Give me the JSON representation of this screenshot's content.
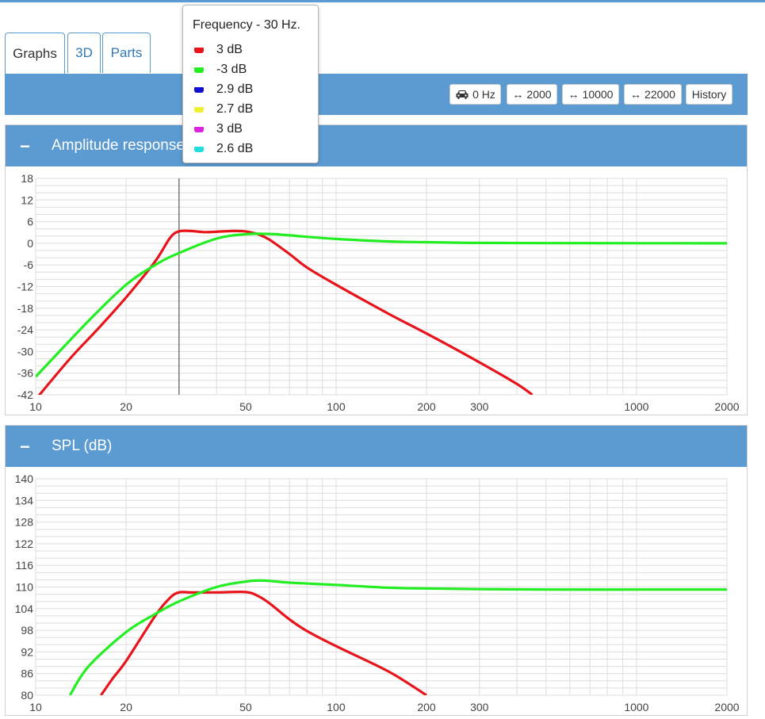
{
  "tabs": [
    {
      "label": "Graphs",
      "active": true
    },
    {
      "label": "3D",
      "active": false
    },
    {
      "label": "Parts",
      "active": false
    }
  ],
  "toolbar": {
    "car": "0 Hz",
    "range2000": "2000",
    "range10000": "10000",
    "range22000": "22000",
    "history": "History"
  },
  "legend": {
    "title": "Frequency - 30 Hz.",
    "items": [
      {
        "color": "#e8141b",
        "label": "3 dB"
      },
      {
        "color": "#22ee22",
        "label": "-3 dB"
      },
      {
        "color": "#1010d0",
        "label": "2.9 dB"
      },
      {
        "color": "#f0f030",
        "label": "2.7 dB"
      },
      {
        "color": "#dd22dd",
        "label": "3 dB"
      },
      {
        "color": "#22dddd",
        "label": "2.6 dB"
      }
    ]
  },
  "chart_data": [
    {
      "type": "line",
      "title": "Amplitude response",
      "xscale": "log",
      "xlim": [
        10,
        2000
      ],
      "ylim": [
        -42,
        18
      ],
      "yticks": [
        18,
        12,
        6,
        0,
        -6,
        -12,
        -18,
        -24,
        -30,
        -36,
        -42
      ],
      "xtick_labels": [
        "10",
        "20",
        "50",
        "100",
        "200",
        "300",
        "1000",
        "2000"
      ],
      "cursor_x": 30,
      "series": [
        {
          "color": "#e8141b",
          "x": [
            10,
            13,
            16,
            20,
            25,
            28,
            30,
            33,
            37,
            45,
            50,
            55,
            60,
            70,
            80,
            100,
            150,
            200,
            300,
            400,
            450
          ],
          "y": [
            -43.3,
            -32,
            -24,
            -15,
            -5,
            1.5,
            3.3,
            3.4,
            3.1,
            3.4,
            3.3,
            2.5,
            1,
            -3,
            -6.7,
            -11.5,
            -19.6,
            -25,
            -33,
            -39,
            -42
          ]
        },
        {
          "color": "#22ee22",
          "x": [
            10,
            15,
            20,
            25,
            30,
            40,
            50,
            60,
            70,
            100,
            150,
            200,
            300,
            500,
            1000,
            2000
          ],
          "y": [
            -37,
            -21.5,
            -11.5,
            -6,
            -2.7,
            1.3,
            2.5,
            2.6,
            2.2,
            1.2,
            0.5,
            0.3,
            0.1,
            0.05,
            0.02,
            0
          ]
        }
      ]
    },
    {
      "type": "line",
      "title": "SPL (dB)",
      "xscale": "log",
      "xlim": [
        10,
        2000
      ],
      "ylim": [
        80,
        140
      ],
      "yticks": [
        140,
        134,
        128,
        122,
        116,
        110,
        104,
        98,
        92,
        86,
        80
      ],
      "xtick_labels": [
        "10",
        "20",
        "50",
        "100",
        "200",
        "300",
        "1000",
        "2000"
      ],
      "series": [
        {
          "color": "#e8141b",
          "x": [
            16.5,
            18,
            20,
            25,
            28,
            30,
            33,
            40,
            50,
            55,
            60,
            70,
            80,
            100,
            150,
            200
          ],
          "y": [
            80,
            84.5,
            89.5,
            102,
            107,
            108.5,
            108.5,
            108.5,
            108.6,
            107.5,
            105.5,
            101,
            97.8,
            93.6,
            86.5,
            80
          ]
        },
        {
          "color": "#22ee22",
          "x": [
            13,
            15,
            20,
            25,
            30,
            40,
            50,
            55,
            60,
            70,
            100,
            150,
            200,
            300,
            500,
            1000,
            2000
          ],
          "y": [
            80,
            88,
            97.5,
            102.5,
            106,
            110,
            111.5,
            111.8,
            111.7,
            111.2,
            110.6,
            109.8,
            109.6,
            109.4,
            109.3,
            109.3,
            109.3
          ]
        }
      ]
    }
  ]
}
